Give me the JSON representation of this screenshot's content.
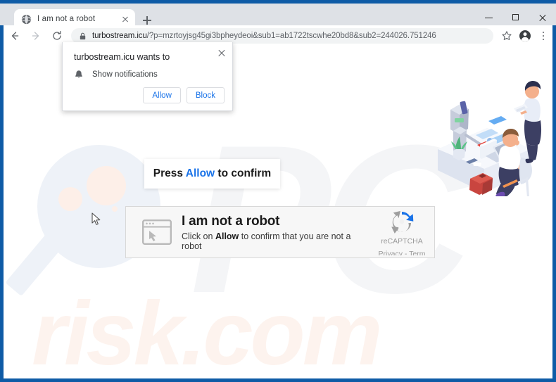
{
  "browser": {
    "tab": {
      "title": "I am not a robot",
      "favicon": "globe-icon",
      "close": "close-tab-icon"
    },
    "new_tab_label": "+",
    "window_controls": {
      "minimize": "minimize-icon",
      "maximize": "maximize-icon",
      "close": "close-window-icon"
    },
    "toolbar": {
      "back": "back-arrow-icon",
      "forward": "forward-arrow-icon",
      "reload": "reload-icon",
      "lock": "lock-icon",
      "url_host": "turbostream.icu",
      "url_path": "/?p=mzrtoyjsg45gi3bpheydeoi&sub1=ab1722tscwhe20bd8&sub2=244026.751246",
      "url_full": "turbostream.icu/?p=mzrtoyjsg45gi3bpheydeoi&sub1=ab1722tscwhe20bd8&sub2=244026.751246",
      "bookmark": "star-icon",
      "profile": "account-avatar-icon",
      "menu": "three-dot-menu-icon"
    }
  },
  "permission_popup": {
    "title": "turbostream.icu wants to",
    "option_icon": "bell-icon",
    "option_label": "Show notifications",
    "allow_label": "Allow",
    "block_label": "Block",
    "close_icon": "close-icon"
  },
  "page": {
    "banner": {
      "prefix": "Press ",
      "highlight": "Allow",
      "suffix": " to confirm"
    },
    "captcha": {
      "icon": "browser-window-cursor-icon",
      "title": "I am not a robot",
      "subtitle_prefix": "Click on ",
      "subtitle_bold": "Allow",
      "subtitle_suffix": " to confirm that you are not a robot",
      "brand_logo": "recaptcha-logo-icon",
      "brand_name": "reCAPTCHA",
      "brand_links": "Privacy - Term"
    },
    "watermark": {
      "big_text": "PC",
      "sub_text": "risk.com",
      "magnifier": "magnifying-glass-watermark"
    },
    "illustration": "office-robot-workers-illustration",
    "cursor": "mouse-pointer"
  },
  "colors": {
    "frame_blue": "#0e5ba6",
    "link_blue": "#1a73e8",
    "tabstrip": "#dee1e6",
    "omnibox": "#f1f3f4",
    "captcha_bg": "#f7f7f7",
    "watermark_peach": "#fdf3ee"
  }
}
